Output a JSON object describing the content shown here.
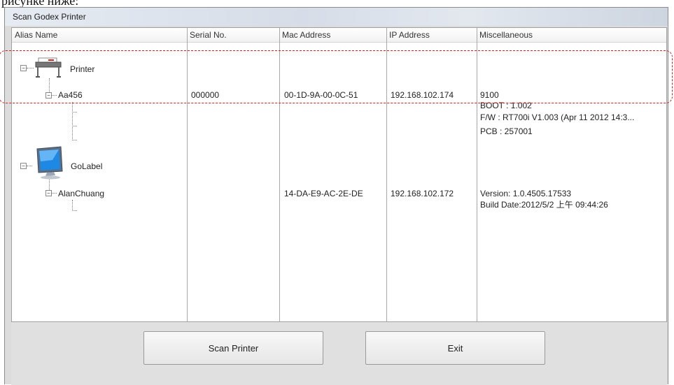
{
  "background_caption": "рисунке ниже:",
  "window": {
    "title": "Scan Godex Printer"
  },
  "columns": [
    "Alias Name",
    "Serial No.",
    "Mac Address",
    "IP Address",
    "Miscellaneous"
  ],
  "tree": {
    "printer_group": {
      "label": "Printer",
      "device": {
        "alias": "Aa456",
        "serial": "000000",
        "mac": "00-1D-9A-00-0C-51",
        "ip": "192.168.102.174",
        "misc": [
          "9100",
          "BOOT : 1.002",
          "F/W : RT700i V1.003 (Apr 11 2012 14:3...",
          "PCB : 257001"
        ]
      }
    },
    "golabel_group": {
      "label": "GoLabel",
      "device": {
        "alias": "AlanChuang",
        "serial": "",
        "mac": "14-DA-E9-AC-2E-DE",
        "ip": "192.168.102.172",
        "misc": [
          "Version: 1.0.4505.17533",
          "Build  Date:2012/5/2 上午 09:44:26"
        ]
      }
    }
  },
  "buttons": {
    "scan": "Scan Printer",
    "exit": "Exit"
  },
  "colors": {
    "highlight": "#d32020",
    "window_bg": "#dcdcdc"
  }
}
